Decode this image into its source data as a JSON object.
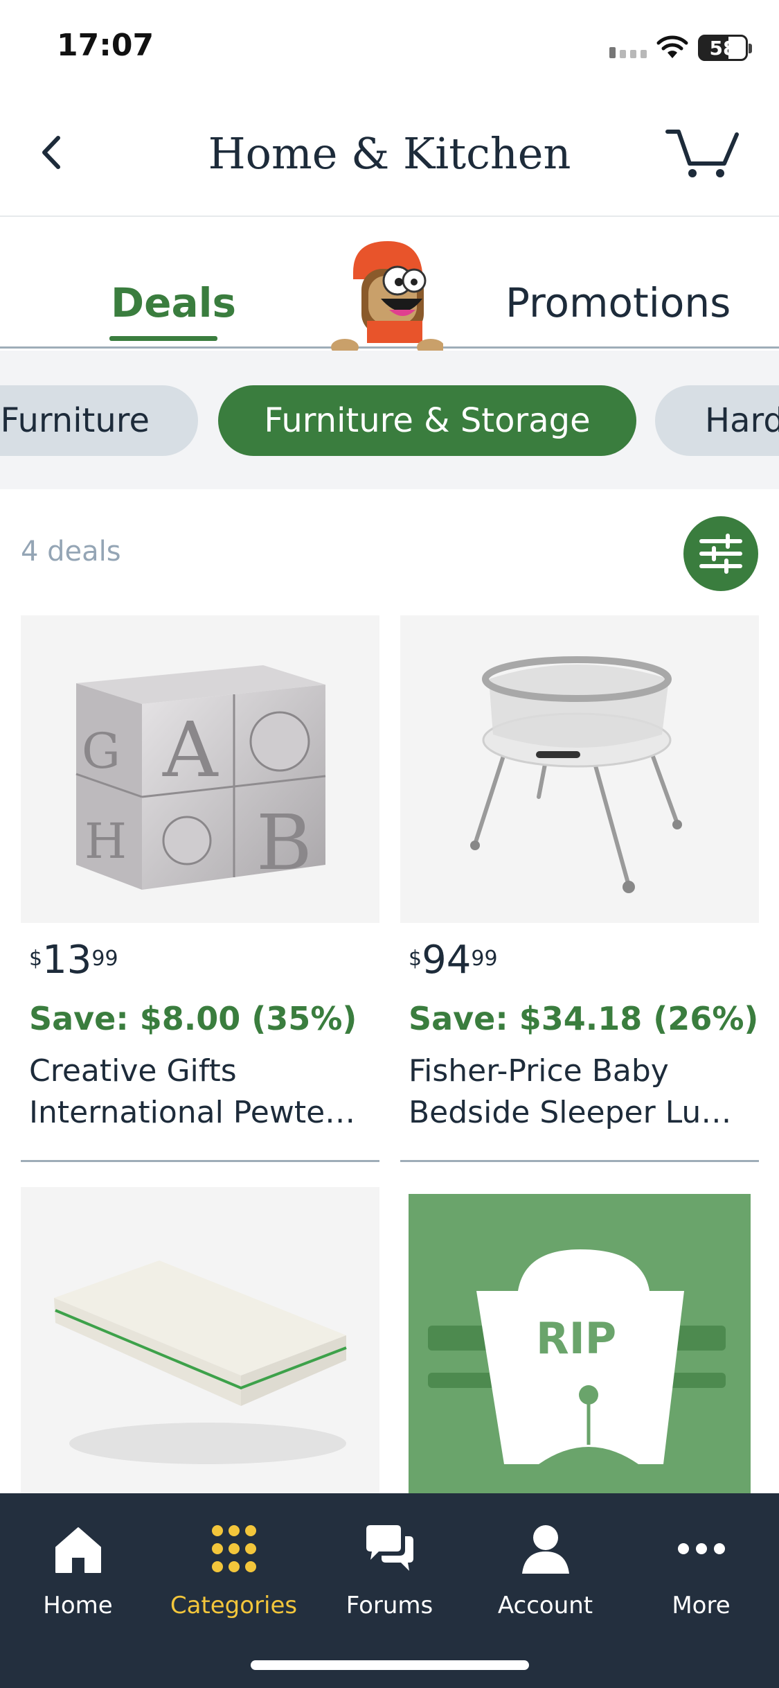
{
  "status_bar": {
    "time": "17:07",
    "battery": "58"
  },
  "header": {
    "title": "Home & Kitchen",
    "back_icon": "chevron-left-icon",
    "cart_icon": "cart-icon"
  },
  "tabs": [
    {
      "label": "Deals",
      "selected": true
    },
    {
      "label": "Promotions",
      "selected": false
    }
  ],
  "categories": [
    {
      "label": "Furniture",
      "selected": false
    },
    {
      "label": "Furniture & Storage",
      "selected": true
    },
    {
      "label": "Hard",
      "selected": false
    }
  ],
  "deals": {
    "count_text": "4 deals",
    "filter_icon": "sliders-icon"
  },
  "products": [
    {
      "price_currency": "$",
      "price_whole": "13",
      "price_fraction": "99",
      "save": "Save: $8.00 (35%)",
      "title_line1": "Creative Gifts",
      "title_line2": "International Pewte…",
      "image": "pewter-alphabet-block-bank"
    },
    {
      "price_currency": "$",
      "price_whole": "94",
      "price_fraction": "99",
      "save": "Save: $34.18 (26%)",
      "title_line1": "Fisher-Price Baby",
      "title_line2": "Bedside Sleeper Lu…",
      "image": "baby-bassinet"
    },
    {
      "image": "crib-mattress"
    },
    {
      "image": "rip-tombstone",
      "image_text": "RIP"
    }
  ],
  "bottom_nav": [
    {
      "label": "Home",
      "icon": "home-icon",
      "active": false
    },
    {
      "label": "Categories",
      "icon": "grid-icon",
      "active": true
    },
    {
      "label": "Forums",
      "icon": "chat-icon",
      "active": false
    },
    {
      "label": "Account",
      "icon": "person-icon",
      "active": false
    },
    {
      "label": "More",
      "icon": "more-icon",
      "active": false
    }
  ],
  "colors": {
    "accent_green": "#3a7d3e",
    "nav_bg": "#232f3e",
    "nav_active": "#f3c63b",
    "chip_bg": "#d7dee4"
  }
}
